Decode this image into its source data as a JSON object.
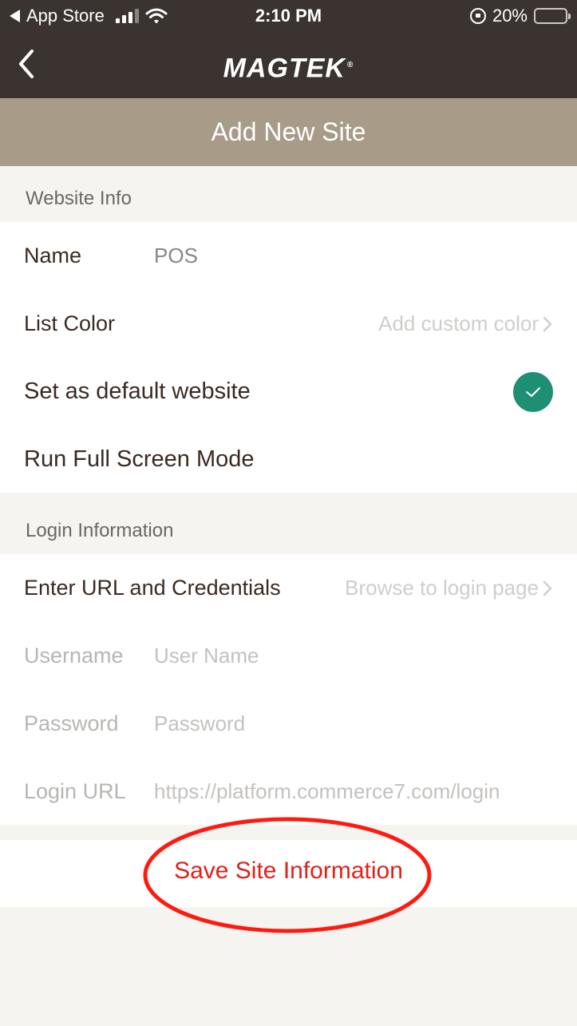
{
  "status_bar": {
    "back_app": "App Store",
    "time": "2:10 PM",
    "battery_text": "20%",
    "battery_level": 0.2
  },
  "nav": {
    "brand": "MAGTEK",
    "brand_mark": "®"
  },
  "title": "Add New Site",
  "website_info": {
    "header": "Website Info",
    "name_label": "Name",
    "name_value": "POS",
    "list_color_label": "List Color",
    "list_color_hint": "Add custom color",
    "default_label": "Set as default website",
    "default_checked": true,
    "fullscreen_label": "Run Full Screen Mode"
  },
  "login_info": {
    "header": "Login Information",
    "url_creds_label": "Enter URL and Credentials",
    "url_creds_hint": "Browse to login page",
    "username_label": "Username",
    "username_placeholder": "User Name",
    "password_label": "Password",
    "password_placeholder": "Password",
    "login_url_label": "Login URL",
    "login_url_value": "https://platform.commerce7.com/login"
  },
  "save_label": "Save Site Information",
  "colors": {
    "header_dark": "#3a3330",
    "title_tan": "#a89c89",
    "check_green": "#1f8f74",
    "save_red": "#e0211b"
  }
}
